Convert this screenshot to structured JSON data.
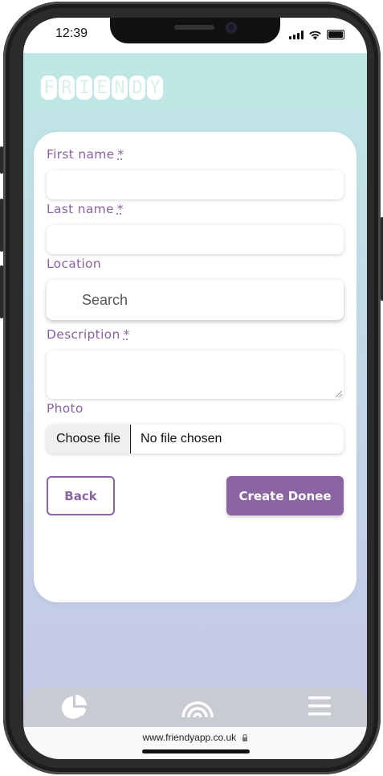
{
  "status_bar": {
    "time": "12:39"
  },
  "logo": {
    "letters": [
      "F",
      "R",
      "I",
      "E",
      "N",
      "D",
      "Y"
    ]
  },
  "form": {
    "first_name_label": "First name",
    "last_name_label": "Last name",
    "location_label": "Location",
    "description_label": "Description",
    "photo_label": "Photo",
    "required_marker": "*",
    "first_name_value": "",
    "last_name_value": "",
    "location_placeholder": "Search",
    "description_value": "",
    "file_button_label": "Choose file",
    "file_status": "No file chosen"
  },
  "actions": {
    "back_label": "Back",
    "create_label": "Create Donee"
  },
  "bottom_nav": {
    "items": [
      "pie-chart-icon",
      "rainbow-icon",
      "menu-icon"
    ]
  },
  "browser": {
    "url": "www.friendyapp.co.uk"
  },
  "colors": {
    "accent": "#8b64a2",
    "bg_top": "#bfe9e4",
    "bg_bottom": "#c6c6e8"
  }
}
